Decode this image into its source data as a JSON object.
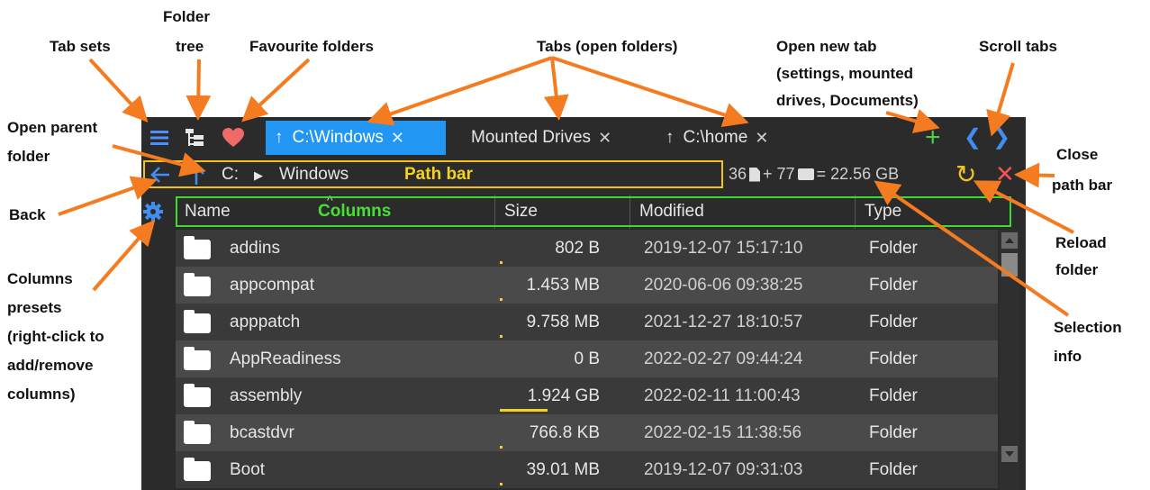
{
  "annotations": {
    "tab_sets": "Tab sets",
    "folder_tree_1": "Folder",
    "folder_tree_2": "tree",
    "favourites": "Favourite folders",
    "tabs": "Tabs (open folders)",
    "new_tab_1": "Open new tab",
    "new_tab_2": "(settings, mounted",
    "new_tab_3": "drives, Documents)",
    "scroll_tabs": "Scroll tabs",
    "open_parent_1": "Open parent",
    "open_parent_2": "folder",
    "close_path_1": "Close",
    "close_path_2": "path bar",
    "back": "Back",
    "reload_1": "Reload",
    "reload_2": "folder",
    "presets_1": "Columns",
    "presets_2": "presets",
    "presets_3": "(right-click to",
    "presets_4": "add/remove",
    "presets_5": "columns)",
    "selection_1": "Selection",
    "selection_2": "info"
  },
  "tabs": [
    {
      "arrow": "↑",
      "label": "C:\\Windows",
      "close": "✕"
    },
    {
      "arrow": "",
      "label": "Mounted Drives",
      "close": "✕"
    },
    {
      "arrow": "↑",
      "label": "C:\\home",
      "close": "✕"
    }
  ],
  "tab_controls": {
    "new_tab": "+",
    "scroll_left": "❮",
    "scroll_right": "❯"
  },
  "path": {
    "drive": "C:",
    "separator": "▶",
    "folder": "Windows",
    "overlay_label": "Path bar"
  },
  "selection_info": {
    "files": "36",
    "plus": "+ 77",
    "equals": "= 22.56 GB"
  },
  "path_controls": {
    "reload": "↻",
    "close": "✕"
  },
  "columns": {
    "name": "Name",
    "size": "Size",
    "modified": "Modified",
    "type": "Type",
    "overlay_label": "Columns",
    "sort_caret": "^"
  },
  "rows": [
    {
      "name": "addins",
      "size": "802 B",
      "modified": "2019-12-07 15:17:10",
      "type": "Folder",
      "size_fraction": 0.01
    },
    {
      "name": "appcompat",
      "size": "1.453 MB",
      "modified": "2020-06-06 09:38:25",
      "type": "Folder",
      "size_fraction": 0.01
    },
    {
      "name": "apppatch",
      "size": "9.758 MB",
      "modified": "2021-12-27 18:10:57",
      "type": "Folder",
      "size_fraction": 0.01
    },
    {
      "name": "AppReadiness",
      "size": "0 B",
      "modified": "2022-02-27 09:44:24",
      "type": "Folder",
      "size_fraction": 0
    },
    {
      "name": "assembly",
      "size": "1.924 GB",
      "modified": "2022-02-11 11:00:43",
      "type": "Folder",
      "size_fraction": 0.35
    },
    {
      "name": "bcastdvr",
      "size": "766.8 KB",
      "modified": "2022-02-15 11:38:56",
      "type": "Folder",
      "size_fraction": 0.01
    },
    {
      "name": "Boot",
      "size": "39.01 MB",
      "modified": "2019-12-07 09:31:03",
      "type": "Folder",
      "size_fraction": 0.02
    }
  ],
  "colors": {
    "annotation_arrow": "#f47b20",
    "active_tab": "#2196f3",
    "path_highlight": "#f4c21e",
    "column_highlight": "#3edb2f",
    "favourite": "#f06a6a",
    "new_tab": "#4cd04c",
    "scroll_tabs": "#3f8ef0",
    "close": "#f25555"
  }
}
